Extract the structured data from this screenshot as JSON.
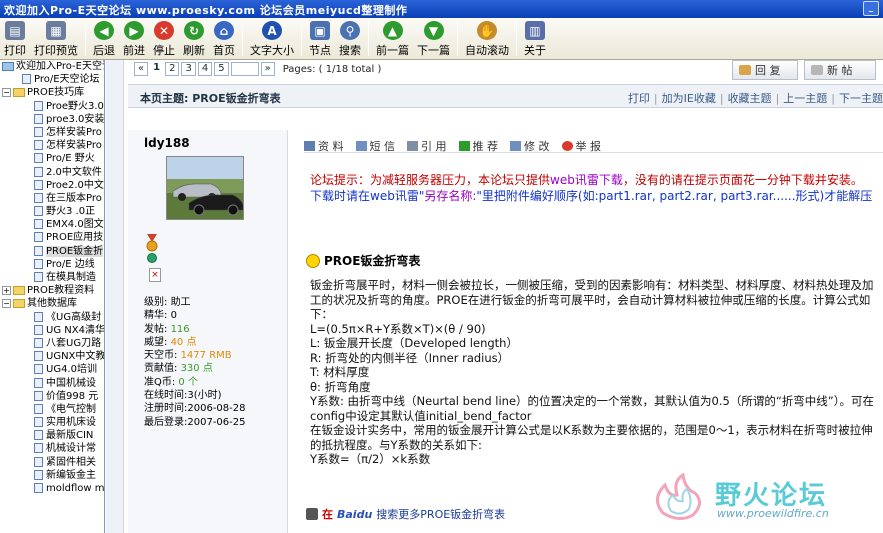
{
  "window": {
    "title": "欢迎加入Pro-E天空论坛  www.proesky.com          论坛会员meiyucd整理制作"
  },
  "toolbar": [
    {
      "name": "print",
      "label": "打印",
      "icon": "printer-icon",
      "color": "#6b7d9c"
    },
    {
      "name": "print-preview",
      "label": "打印预览",
      "icon": "print-preview-icon",
      "color": "#6b7d9c"
    },
    {
      "name": "back",
      "label": "后退",
      "icon": "back-arrow-icon",
      "color": "#2d9b2d"
    },
    {
      "name": "forward",
      "label": "前进",
      "icon": "forward-arrow-icon",
      "color": "#2d9b2d"
    },
    {
      "name": "stop",
      "label": "停止",
      "icon": "stop-icon",
      "color": "#d83a2e"
    },
    {
      "name": "refresh",
      "label": "刷新",
      "icon": "refresh-icon",
      "color": "#2d9b2d"
    },
    {
      "name": "home",
      "label": "首页",
      "icon": "home-icon",
      "color": "#3769c4"
    },
    {
      "name": "font-size",
      "label": "文字大小",
      "icon": "font-size-icon",
      "color": "#2050b0"
    },
    {
      "name": "nodes",
      "label": "节点",
      "icon": "nodes-icon",
      "color": "#4a72b0"
    },
    {
      "name": "search",
      "label": "搜索",
      "icon": "search-icon",
      "color": "#4a72b0"
    },
    {
      "name": "prev-page",
      "label": "前一篇",
      "icon": "up-arrow-icon",
      "color": "#2d9b2d"
    },
    {
      "name": "next-page",
      "label": "下一篇",
      "icon": "down-arrow-icon",
      "color": "#2d9b2d"
    },
    {
      "name": "auto-scroll",
      "label": "自动滚动",
      "icon": "hand-icon",
      "color": "#c58a2a"
    },
    {
      "name": "about",
      "label": "关于",
      "icon": "book-icon",
      "color": "#5a6fa8"
    }
  ],
  "tree": [
    {
      "level": 0,
      "type": "root",
      "label": "欢迎加入Pro-E天空论坛"
    },
    {
      "level": 1,
      "type": "doc",
      "label": "Pro/E天空论坛"
    },
    {
      "level": 0,
      "type": "folder",
      "expanded": true,
      "label": "PROE技巧库"
    },
    {
      "level": 2,
      "type": "doc",
      "label": "Proe野火3.0"
    },
    {
      "level": 2,
      "type": "doc",
      "label": "proe3.0安装"
    },
    {
      "level": 2,
      "type": "doc",
      "label": "怎样安装Pro"
    },
    {
      "level": 2,
      "type": "doc",
      "label": "怎样安装Pro"
    },
    {
      "level": 2,
      "type": "doc",
      "label": "Pro/E 野火"
    },
    {
      "level": 2,
      "type": "doc",
      "label": "2.0中文软件"
    },
    {
      "level": 2,
      "type": "doc",
      "label": "Proe2.0中文"
    },
    {
      "level": 2,
      "type": "doc",
      "label": "在三版本Pro"
    },
    {
      "level": 2,
      "type": "doc",
      "label": "野火3 .0正"
    },
    {
      "level": 2,
      "type": "doc",
      "label": "EMX4.0图文"
    },
    {
      "level": 2,
      "type": "doc",
      "label": "PROE应用技"
    },
    {
      "level": 2,
      "type": "doc",
      "label": "PROE钣金折",
      "selected": true
    },
    {
      "level": 2,
      "type": "doc",
      "label": "Pro/E 边线"
    },
    {
      "level": 2,
      "type": "doc",
      "label": "在模具制造"
    },
    {
      "level": 0,
      "type": "folder",
      "expanded": false,
      "label": "PROE教程资料"
    },
    {
      "level": 0,
      "type": "folder",
      "expanded": true,
      "label": "其他数据库"
    },
    {
      "level": 2,
      "type": "doc",
      "label": "《UG高级封"
    },
    {
      "level": 2,
      "type": "doc",
      "label": "UG NX4清华"
    },
    {
      "level": 2,
      "type": "doc",
      "label": "八套UG刀路"
    },
    {
      "level": 2,
      "type": "doc",
      "label": "UGNX中文教"
    },
    {
      "level": 2,
      "type": "doc",
      "label": "UG4.0培训"
    },
    {
      "level": 2,
      "type": "doc",
      "label": "中国机械设"
    },
    {
      "level": 2,
      "type": "doc",
      "label": "价值998 元"
    },
    {
      "level": 2,
      "type": "doc",
      "label": "《电气控制"
    },
    {
      "level": 2,
      "type": "doc",
      "label": "实用机床设"
    },
    {
      "level": 2,
      "type": "doc",
      "label": "最新版CIN"
    },
    {
      "level": 2,
      "type": "doc",
      "label": "机械设计常"
    },
    {
      "level": 2,
      "type": "doc",
      "label": "紧固件相关"
    },
    {
      "level": 2,
      "type": "doc",
      "label": "新编钣金主"
    },
    {
      "level": 2,
      "type": "doc",
      "label": "moldflow m"
    }
  ],
  "pager": {
    "prev": "«",
    "pages": [
      "1",
      "2",
      "3",
      "4",
      "5"
    ],
    "current": "1",
    "next": "»",
    "total": "Pages: ( 1/18 total )"
  },
  "topbuttons": {
    "reply": "回 复",
    "new_post": "新 帖"
  },
  "subject": {
    "title": "本页主题: PROE钣金折弯表",
    "links": [
      "打印",
      "加为IE收藏",
      "收藏主题",
      "上一主题",
      "下一主题"
    ]
  },
  "user": {
    "name": "ldy188",
    "stats": [
      {
        "label": "级别: ",
        "value": "助工",
        "style": ""
      },
      {
        "label": "精华: ",
        "value": "0",
        "style": ""
      },
      {
        "label": "发帖: ",
        "value": "116",
        "style": "green"
      },
      {
        "label": "威望: ",
        "value": "40 点",
        "style": "orange"
      },
      {
        "label": "天空币: ",
        "value": "1477 RMB",
        "style": "orange"
      },
      {
        "label": "贡献值: ",
        "value": "330 点",
        "style": "green"
      },
      {
        "label": "准Q币: ",
        "value": "0 个",
        "style": "green"
      },
      {
        "label": "在线时间:",
        "value": "3(小时)",
        "style": ""
      },
      {
        "label": "注册时间:",
        "value": "2006-08-28",
        "style": ""
      },
      {
        "label": "最后登录:",
        "value": "2007-06-25",
        "style": ""
      }
    ]
  },
  "post": {
    "actions": [
      {
        "label": "资 料",
        "icon": "profile-icon"
      },
      {
        "label": "短 信",
        "icon": "message-icon"
      },
      {
        "label": "引 用",
        "icon": "quote-icon"
      },
      {
        "label": "推 荐",
        "icon": "recommend-icon"
      },
      {
        "label": "修 改",
        "icon": "edit-icon"
      },
      {
        "label": "举 报",
        "icon": "report-icon"
      }
    ],
    "notice": {
      "line1_a": "论坛提示：为减轻服务器压力，本论坛只提供",
      "line1_b": "web讯雷下载",
      "line1_c": "，没有的请在提示页面花一分钟下载并安装。",
      "line2_a": "下载时请在web讯雷\"",
      "line2_b": "另存名称:",
      "line2_c": "\"里把附件编好顺序(如:part1.rar, part2.rar, part3.rar......形式)才能解压"
    },
    "heading": "PROE钣金折弯表",
    "body": [
      "钣金折弯展平时，材料一侧会被拉长，一侧被压缩，受到的因素影响有：材料类型、材料厚度、材料热处理及加工的状况及折弯的角度。PROE在进行钣金的折弯可展平时，会自动计算材料被拉伸或压缩的长度。计算公式如下：",
      "L=(0.5π×R+Y系数×T)×(θ / 90)",
      "L: 钣金展开长度（Developed length）",
      "R: 折弯处的内侧半径（Inner radius）",
      "T: 材料厚度",
      "θ: 折弯角度",
      "Y系数: 由折弯中线（Neurtal bend line）的位置决定的一个常数，其默认值为0.5（所谓的“折弯中线”）。可在config中设定其默认值initial_bend_factor",
      "在钣金设计实务中，常用的钣金展开计算公式是以K系数为主要依据的，范围是0～1，表示材料在折弯时被拉伸的抵抗程度。与Y系数的关系如下:",
      "Y系数=（π/2）×k系数"
    ],
    "footer": {
      "zai": "在",
      "baidu": "Baidu",
      "more": "搜索更多PROE钣金折弯表"
    }
  },
  "watermark": {
    "brand": "野火论坛",
    "url": "www.proewildfire.cn"
  }
}
